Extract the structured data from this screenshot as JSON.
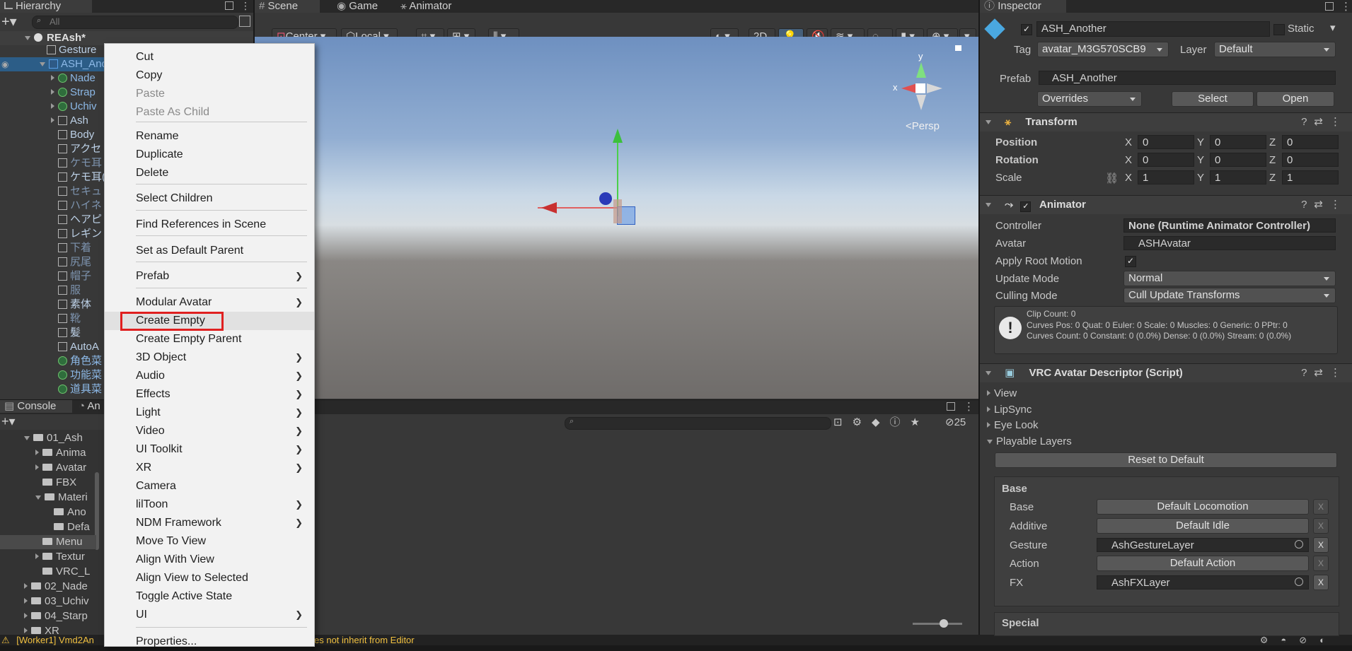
{
  "hierarchy": {
    "tab": "Hierarchy",
    "search_placeholder": "All",
    "scene_name": "REAsh*",
    "rows": [
      "Gesture",
      "ASH_Ano",
      "Nade",
      "Strap",
      "Uchiv",
      "Ash",
      "Body",
      "アクセ",
      "ケモ耳",
      "ケモ耳(",
      "セキュ",
      "ハイネ",
      "ヘアピ",
      "レギン",
      "下着",
      "尻尾",
      "帽子",
      "服",
      "素体",
      "靴",
      "髪",
      "AutoA",
      "角色菜",
      "功能菜",
      "道具菜"
    ]
  },
  "scene_tabs": [
    "Scene",
    "Game",
    "Animator"
  ],
  "scene_toolbar": {
    "center": "Center",
    "local": "Local",
    "mode_2d": "2D",
    "persp": "<Persp",
    "gizmo_x": "x",
    "gizmo_y": "y"
  },
  "console": {
    "tab": "Console",
    "tab2": "An",
    "count": "25",
    "status": "[Worker1] Vmd2An",
    "status2": "es not inherit from Editor"
  },
  "project": {
    "rows": [
      "01_Ash",
      "Anima",
      "Avatar",
      "FBX",
      "Materi",
      "Ano",
      "Defa",
      "Menu",
      "Textur",
      "VRC_L",
      "02_Nade",
      "03_Uchiv",
      "04_Starp",
      "XR"
    ]
  },
  "context_menu": {
    "items": [
      "Cut",
      "Copy",
      "Paste",
      "Paste As Child",
      "Rename",
      "Duplicate",
      "Delete",
      "Select Children",
      "Find References in Scene",
      "Set as Default Parent",
      "Prefab",
      "Modular Avatar",
      "Create Empty",
      "Create Empty Parent",
      "3D Object",
      "Audio",
      "Effects",
      "Light",
      "Video",
      "UI Toolkit",
      "XR",
      "Camera",
      "lilToon",
      "NDM Framework",
      "Move To View",
      "Align With View",
      "Align View to Selected",
      "Toggle Active State",
      "UI",
      "Properties..."
    ],
    "highlighted": "Create Empty"
  },
  "inspector": {
    "tab": "Inspector",
    "object_name": "ASH_Another",
    "static_label": "Static",
    "tag_label": "Tag",
    "tag_value": "avatar_M3G570SCB9",
    "layer_label": "Layer",
    "layer_value": "Default",
    "prefab_label": "Prefab",
    "prefab_value": "ASH_Another",
    "overrides": "Overrides",
    "select": "Select",
    "open": "Open",
    "transform": {
      "title": "Transform",
      "position": "Position",
      "rotation": "Rotation",
      "scale": "Scale",
      "pos": [
        "0",
        "0",
        "0"
      ],
      "rot": [
        "0",
        "0",
        "0"
      ],
      "scl": [
        "1",
        "1",
        "1"
      ],
      "axes": [
        "X",
        "Y",
        "Z"
      ]
    },
    "animator": {
      "title": "Animator",
      "controller_label": "Controller",
      "controller_value": "None (Runtime Animator Controller)",
      "avatar_label": "Avatar",
      "avatar_value": "ASHAvatar",
      "root_motion_label": "Apply Root Motion",
      "update_mode_label": "Update Mode",
      "update_mode_value": "Normal",
      "culling_label": "Culling Mode",
      "culling_value": "Cull Update Transforms",
      "info1": "Clip Count: 0",
      "info2": "Curves Pos: 0 Quat: 0 Euler: 0 Scale: 0 Muscles: 0 Generic: 0 PPtr: 0",
      "info3": "Curves Count: 0 Constant: 0 (0.0%) Dense: 0 (0.0%) Stream: 0 (0.0%)"
    },
    "vrc": {
      "title": "VRC Avatar Descriptor (Script)",
      "view": "View",
      "lipsync": "LipSync",
      "eyelook": "Eye Look",
      "playable": "Playable Layers",
      "reset": "Reset to Default",
      "base_header": "Base",
      "layers": [
        {
          "name": "Base",
          "value": "Default Locomotion"
        },
        {
          "name": "Additive",
          "value": "Default Idle"
        },
        {
          "name": "Gesture",
          "value": "AshGestureLayer"
        },
        {
          "name": "Action",
          "value": "Default Action"
        },
        {
          "name": "FX",
          "value": "AshFXLayer"
        }
      ],
      "x": "X",
      "special": "Special"
    }
  }
}
